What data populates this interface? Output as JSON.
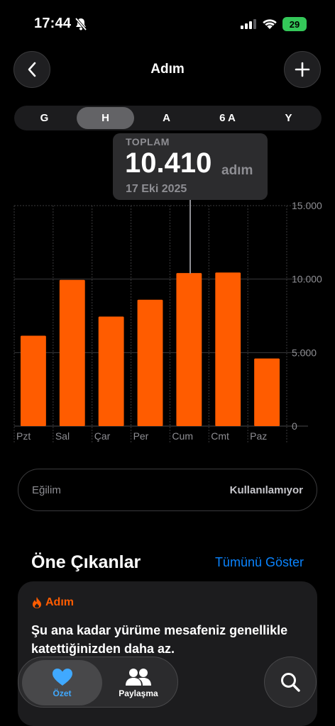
{
  "status_bar": {
    "time": "17:44",
    "battery": "29"
  },
  "nav": {
    "title": "Adım",
    "back_icon": "chevron-left-icon",
    "add_icon": "plus-icon"
  },
  "segments": [
    "G",
    "H",
    "A",
    "6 A",
    "Y"
  ],
  "selected_segment": "H",
  "tooltip": {
    "label": "TOPLAM",
    "value": "10.410",
    "unit": "adım",
    "date": "17 Eki 2025"
  },
  "chart_data": {
    "type": "bar",
    "categories": [
      "Pzt",
      "Sal",
      "Çar",
      "Per",
      "Cum",
      "Cmt",
      "Paz"
    ],
    "values": [
      6150,
      9950,
      7450,
      8600,
      10410,
      10450,
      4600
    ],
    "y_ticks": [
      "15.000",
      "10.000",
      "5.000",
      "0"
    ],
    "ylim": [
      0,
      15000
    ],
    "highlighted": "Cum",
    "bar_color": "#ff5c00",
    "grid": true
  },
  "trend": {
    "label": "Eğilim",
    "value": "Kullanılamıyor"
  },
  "highlights": {
    "title": "Öne Çıkanlar",
    "show_all": "Tümünü Göster",
    "card": {
      "category": "Adım",
      "icon": "flame-icon",
      "text": "Şu ana kadar yürüme mesafeniz genellikle katettiğinizden daha az."
    }
  },
  "tabbar": {
    "tabs": [
      {
        "label": "Özet",
        "icon": "heart-icon"
      },
      {
        "label": "Paylaşma",
        "icon": "people-icon"
      }
    ],
    "search_icon": "search-icon"
  },
  "colors": {
    "accent": "#ff5c00",
    "link": "#0a84ff",
    "active_tab": "#40a9ff",
    "battery": "#34c759"
  }
}
